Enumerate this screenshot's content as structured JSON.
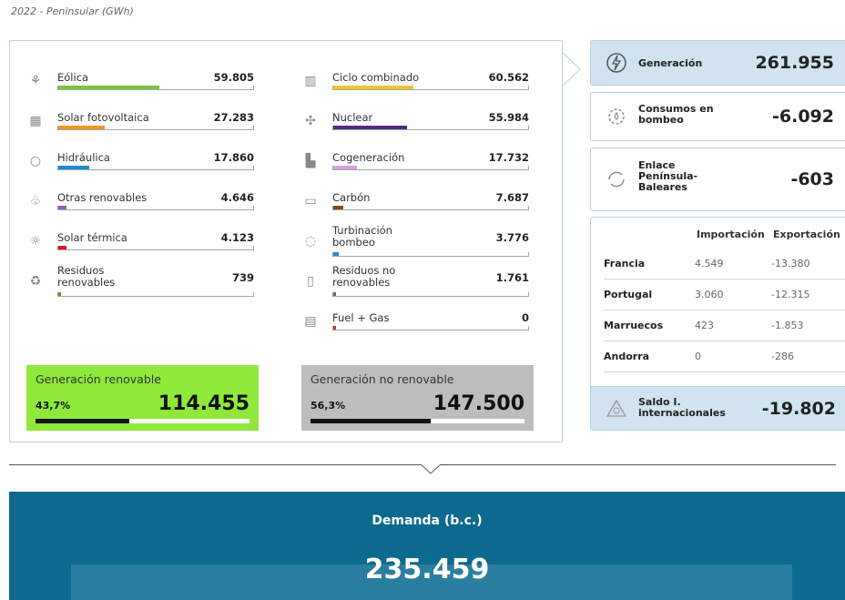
{
  "subtitle": "2022 - Peninsular (GWh)",
  "renewables": [
    {
      "name": "Eólica",
      "value": "59.805",
      "color": "#7dc242",
      "icon": "wind-turbine-icon",
      "share": 0.52
    },
    {
      "name": "Solar fotovoltaica",
      "value": "27.283",
      "color": "#f7941d",
      "icon": "solar-panel-icon",
      "share": 0.24
    },
    {
      "name": "Hidráulica",
      "value": "17.860",
      "color": "#1f8ad3",
      "icon": "water-drop-icon",
      "share": 0.16
    },
    {
      "name": "Otras renovables",
      "value": "4.646",
      "color": "#9b59b6",
      "icon": "leaf-hand-icon",
      "share": 0.04
    },
    {
      "name": "Solar térmica",
      "value": "4.123",
      "color": "#e3131b",
      "icon": "sun-icon",
      "share": 0.04
    },
    {
      "name": "Residuos renovables",
      "value": "739",
      "color": "#6b8e23",
      "icon": "recycle-bin-icon",
      "share": 0.01
    }
  ],
  "non_renewables": [
    {
      "name": "Ciclo combinado",
      "value": "60.562",
      "color": "#f4c430",
      "icon": "power-plant-icon",
      "share": 0.41
    },
    {
      "name": "Nuclear",
      "value": "55.984",
      "color": "#4b2e83",
      "icon": "nuclear-icon",
      "share": 0.38
    },
    {
      "name": "Cogeneración",
      "value": "17.732",
      "color": "#d89fd9",
      "icon": "factory-icon",
      "share": 0.12
    },
    {
      "name": "Carbón",
      "value": "7.687",
      "color": "#8b4513",
      "icon": "coal-cart-icon",
      "share": 0.05
    },
    {
      "name": "Turbinación bombeo",
      "value": "3.776",
      "color": "#1f8ad3",
      "icon": "pump-drop-icon",
      "share": 0.03
    },
    {
      "name": "Residuos no renovables",
      "value": "1.761",
      "color": "#6b6b6b",
      "icon": "waste-bin-icon",
      "share": 0.01
    },
    {
      "name": "Fuel + Gas",
      "value": "0",
      "color": "#c0392b",
      "icon": "fuel-tank-icon",
      "share": 0.0
    }
  ],
  "summary": {
    "renewable": {
      "label": "Generación renovable",
      "percent": "43,7%",
      "total": "114.455",
      "share": 0.437
    },
    "non_renewable": {
      "label": "Generación no renovable",
      "percent": "56,3%",
      "total": "147.500",
      "share": 0.563
    }
  },
  "cards": {
    "generation": {
      "label": "Generación",
      "value": "261.955",
      "icon": "lightning-icon"
    },
    "pumping": {
      "label": "Consumos en bombeo",
      "value": "-6.092",
      "icon": "gear-drop-icon"
    },
    "link": {
      "label": "Enlace Península-Baleares",
      "value": "-603",
      "icon": "cycle-arrows-icon"
    }
  },
  "international": {
    "headers": {
      "import": "Importación",
      "export": "Exportación"
    },
    "rows": [
      {
        "country": "Francia",
        "import": "4.549",
        "export": "-13.380"
      },
      {
        "country": "Portugal",
        "import": "3.060",
        "export": "-12.315"
      },
      {
        "country": "Marruecos",
        "import": "423",
        "export": "-1.853"
      },
      {
        "country": "Andorra",
        "import": "0",
        "export": "-286"
      }
    ],
    "balance": {
      "label": "Saldo I. internacionales",
      "value": "-19.802",
      "icon": "globe-triangle-icon"
    }
  },
  "demand": {
    "label": "Demanda (b.c.)",
    "value": "235.459"
  }
}
